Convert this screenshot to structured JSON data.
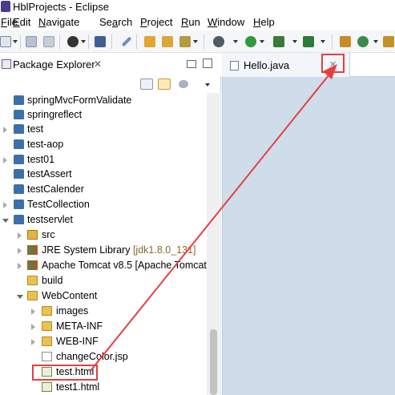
{
  "window": {
    "title": "HblProjects - Eclipse"
  },
  "menu": [
    {
      "pre": "",
      "u": "F",
      "post": "ile"
    },
    {
      "pre": "",
      "u": "E",
      "post": "dit"
    },
    {
      "pre": "",
      "u": "N",
      "post": "avigate"
    },
    {
      "pre": "Se",
      "u": "a",
      "post": "rch"
    },
    {
      "pre": "",
      "u": "P",
      "post": "roject"
    },
    {
      "pre": "",
      "u": "R",
      "post": "un"
    },
    {
      "pre": "",
      "u": "W",
      "post": "indow"
    },
    {
      "pre": "",
      "u": "H",
      "post": "elp"
    }
  ],
  "package_explorer": {
    "tab_label": "Package Explorer",
    "close_glyph": "✕"
  },
  "tree": [
    {
      "label": "springMvcFormValidate"
    },
    {
      "label": "springreflect"
    },
    {
      "label": "test"
    },
    {
      "label": "test-aop"
    },
    {
      "label": "test01"
    },
    {
      "label": "testAssert"
    },
    {
      "label": "testCalender"
    },
    {
      "label": "TestCollection"
    },
    {
      "label": "testservlet"
    },
    {
      "label": "src"
    },
    {
      "label": "JRE System Library",
      "suffix": "[jdk1.8.0_131]"
    },
    {
      "label": "Apache Tomcat v8.5 [Apache Tomcat"
    },
    {
      "label": "build"
    },
    {
      "label": "WebContent"
    },
    {
      "label": "images"
    },
    {
      "label": "META-INF"
    },
    {
      "label": "WEB-INF"
    },
    {
      "label": "changeColor.jsp"
    },
    {
      "label": "test.html"
    },
    {
      "label": "test1.html"
    }
  ],
  "editor": {
    "tab_label": "Hello.java",
    "close_glyph": "✕"
  },
  "colors": {
    "annotation": "#e34040",
    "editor_bg": "#cfdcea",
    "project_icon": "#3d6fa8",
    "folder_icon": "#e9c24f"
  }
}
